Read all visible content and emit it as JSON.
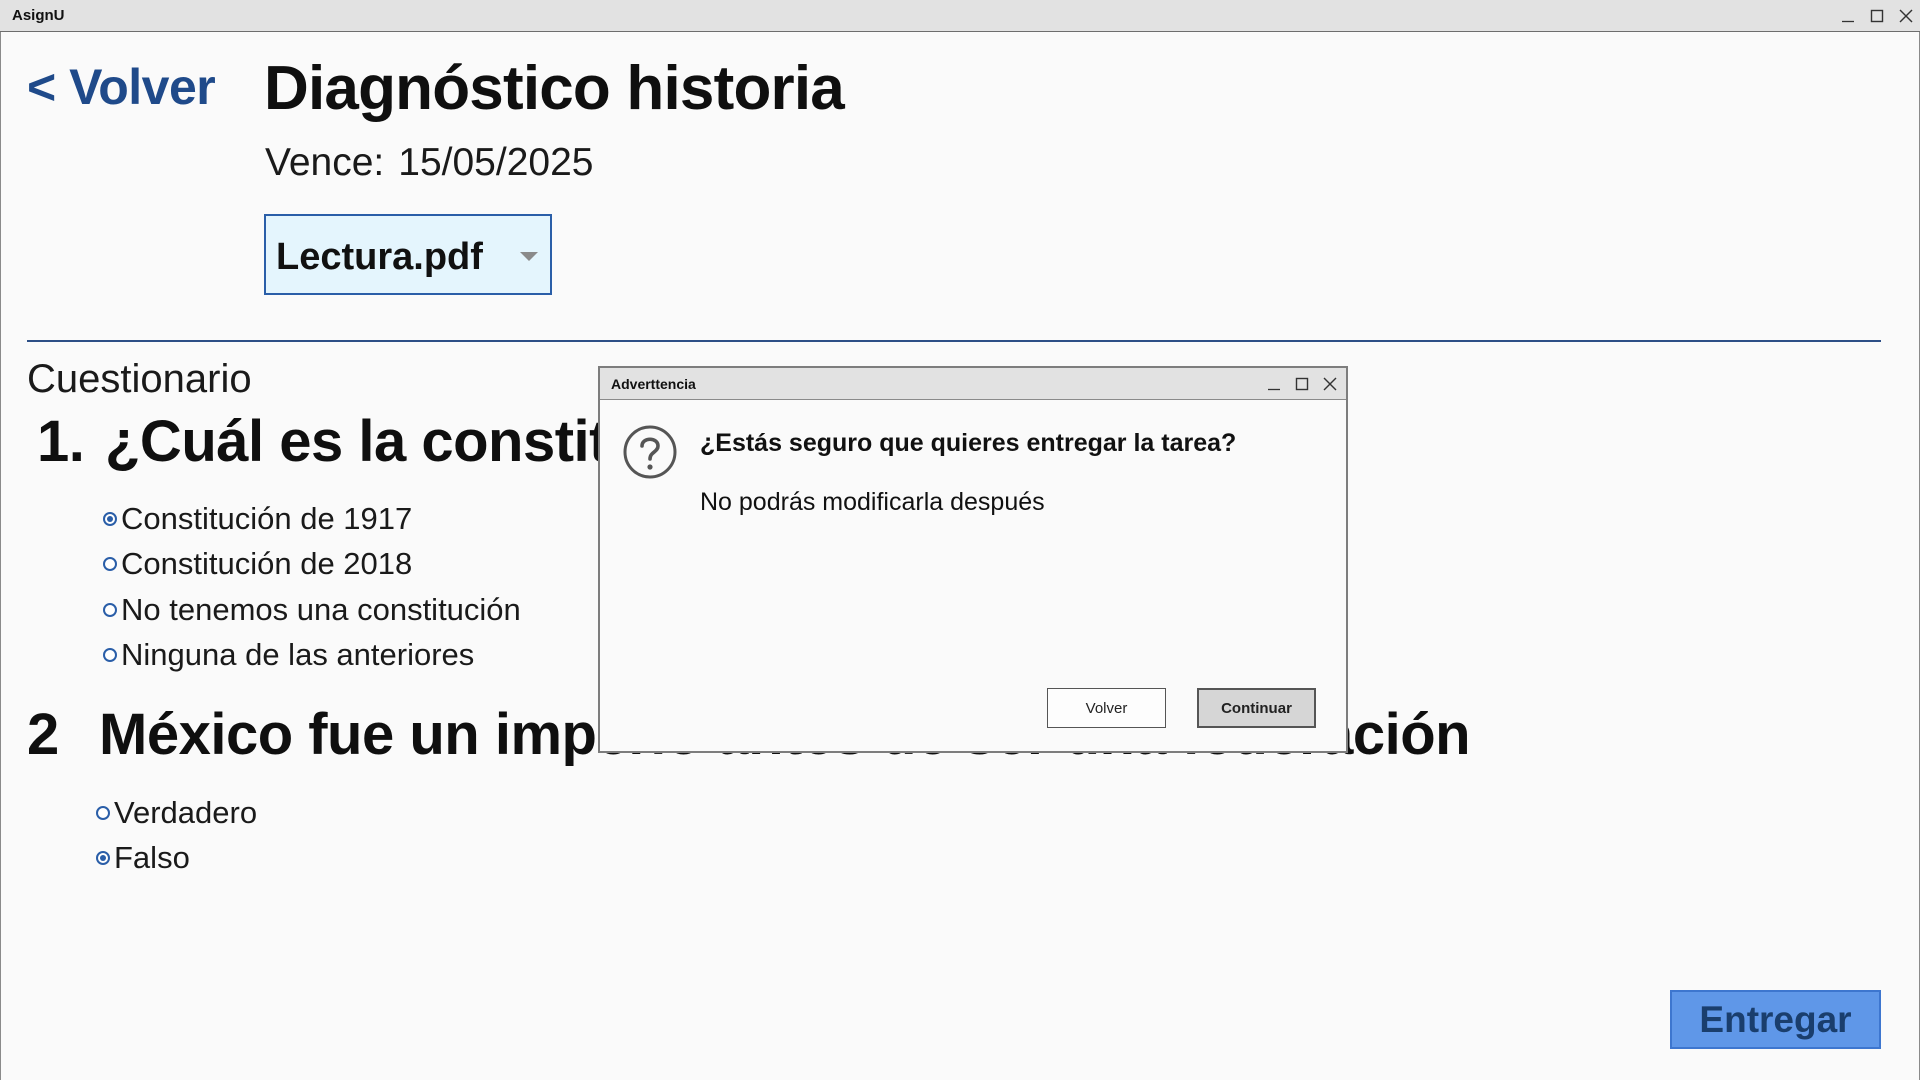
{
  "app": {
    "title": "AsignU"
  },
  "header": {
    "back_label": "< Volver",
    "title": "Diagnóstico historia",
    "due_label": "Vence:",
    "due_date": "15/05/2025"
  },
  "file_select": {
    "value": "Lectura.pdf"
  },
  "quiz": {
    "section_label": "Cuestionario",
    "questions": [
      {
        "number": "1.",
        "text": "¿Cuál es la constitución vigente?",
        "options": [
          {
            "label": "Constitución de 1917",
            "selected": true
          },
          {
            "label": "Constitución de 2018",
            "selected": false
          },
          {
            "label": "No tenemos una constitución",
            "selected": false
          },
          {
            "label": "Ninguna de las anteriores",
            "selected": false
          }
        ]
      },
      {
        "number": "2",
        "text": "México fue un imperio antes de ser una federación",
        "options": [
          {
            "label": "Verdadero",
            "selected": false
          },
          {
            "label": "Falso",
            "selected": true
          }
        ]
      }
    ]
  },
  "submit_label": "Entregar",
  "dialog": {
    "title": "Adverttencia",
    "icon": "question-icon",
    "heading": "¿Estás seguro que quieres entregar la tarea?",
    "message": "No podrás modificarla después",
    "back_label": "Volver",
    "continue_label": "Continuar"
  },
  "colors": {
    "accent": "#1f4a8a",
    "radio": "#2a5ea8",
    "submit_bg": "#5f97e8",
    "select_bg": "#e4f5fd"
  }
}
